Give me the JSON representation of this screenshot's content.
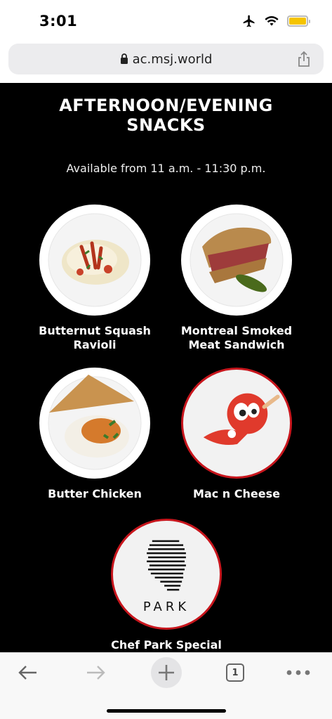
{
  "status_bar": {
    "time": "3:01"
  },
  "browser": {
    "url": "ac.msj.world"
  },
  "page": {
    "title": "AFTERNOON/EVENING SNACKS",
    "subtitle": "Available from 11 a.m. - 11:30 p.m.",
    "items": [
      {
        "label": "Butternut Squash Ravioli"
      },
      {
        "label": "Montreal Smoked Meat Sandwich"
      },
      {
        "label": "Butter Chicken"
      },
      {
        "label": "Mac n Cheese"
      },
      {
        "label": "Chef Park Special",
        "logo_text": "PARK"
      }
    ]
  },
  "toolbar": {
    "tab_count": "1"
  },
  "colors": {
    "accent_red": "#c8161d",
    "battery": "#f5c400"
  }
}
